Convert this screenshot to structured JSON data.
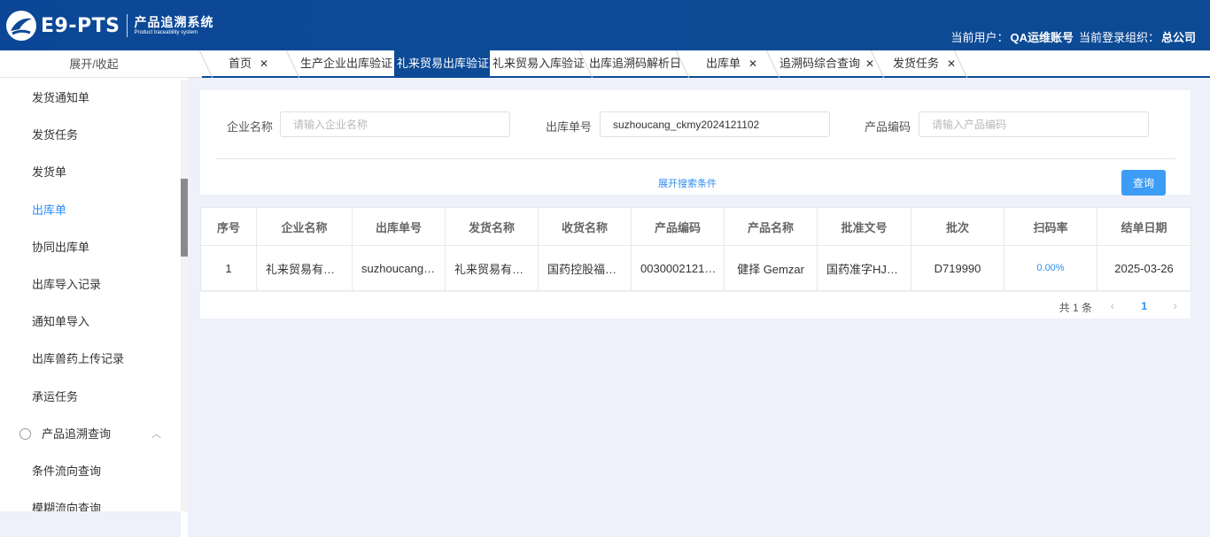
{
  "header": {
    "logo_text": "E9-PTS",
    "system_name": "产品追溯系统",
    "system_name_en": "Product traceability system",
    "user_label": "当前用户：",
    "user_name": "QA运维账号",
    "org_label": "当前登录组织：",
    "org_name": "总公司"
  },
  "sidebar": {
    "toggle_label": "展开/收起",
    "items": [
      {
        "label": "发货通知单"
      },
      {
        "label": "发货任务"
      },
      {
        "label": "发货单"
      },
      {
        "label": "出库单"
      },
      {
        "label": "协同出库单"
      },
      {
        "label": "出库导入记录"
      },
      {
        "label": "通知单导入"
      },
      {
        "label": "出库兽药上传记录"
      },
      {
        "label": "承运任务"
      }
    ],
    "group": {
      "label": "产品追溯查询",
      "icon": "globe-icon"
    },
    "sub_items": [
      {
        "label": "条件流向查询"
      },
      {
        "label": "模糊流向查询"
      }
    ]
  },
  "tabs": [
    {
      "label": "首页",
      "closable": true
    },
    {
      "label": "生产企业出库验证",
      "closable": false
    },
    {
      "label": "礼来贸易出库验证",
      "closable": false,
      "active": true
    },
    {
      "label": "礼来贸易入库验证",
      "closable": false
    },
    {
      "label": "出库追溯码解析日",
      "closable": false
    },
    {
      "label": "出库单",
      "closable": true
    },
    {
      "label": "追溯码综合查询",
      "closable": true
    },
    {
      "label": "发货任务",
      "closable": true
    }
  ],
  "search": {
    "company_label": "企业名称",
    "company_placeholder": "请输入企业名称",
    "company_value": "",
    "order_label": "出库单号",
    "order_value": "suzhoucang_ckmy2024121102",
    "product_label": "产品编码",
    "product_placeholder": "请输入产品编码",
    "product_value": "",
    "expand_label": "展开搜索条件",
    "query_label": "查询"
  },
  "table": {
    "columns": [
      "序号",
      "企业名称",
      "出库单号",
      "发货名称",
      "收货名称",
      "产品编码",
      "产品名称",
      "批准文号",
      "批次",
      "扫码率",
      "结单日期"
    ],
    "rows": [
      {
        "index": "1",
        "company": "礼来贸易有…",
        "order_no": "suzhoucang…",
        "sender": "礼来贸易有…",
        "receiver": "国药控股福…",
        "product_code": "0030002121…",
        "product_name": "健择 Gemzar",
        "approval_no": "国药准字HJ2…",
        "batch": "D719990",
        "scan_rate": "0.00%",
        "close_date": "2025-03-26"
      }
    ]
  },
  "pagination": {
    "total_text": "共 1 条",
    "current_page": "1"
  }
}
